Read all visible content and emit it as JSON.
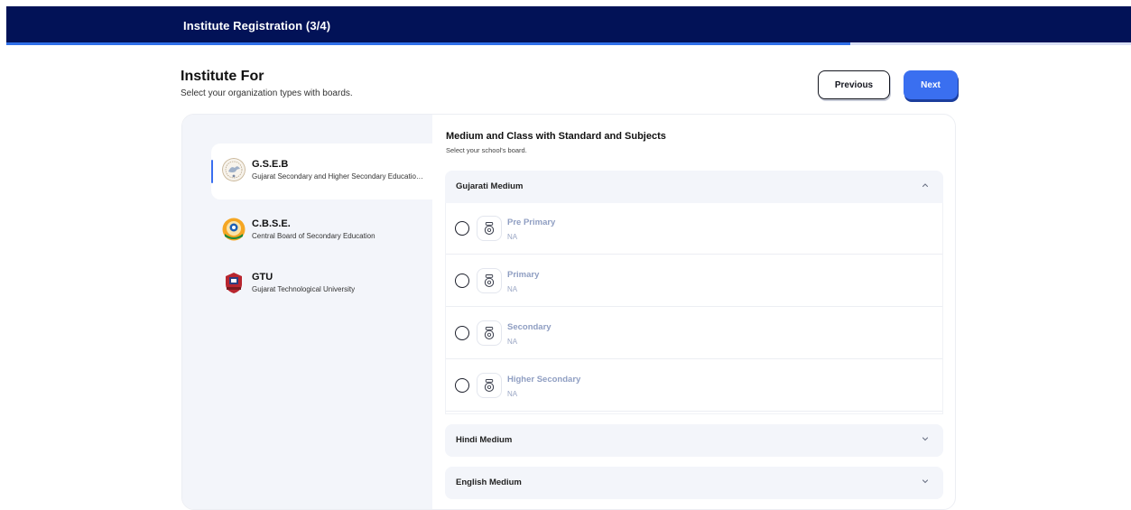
{
  "header": {
    "title": "Institute Registration (3/4)",
    "progress_percent": 75
  },
  "page": {
    "title": "Institute For",
    "subtitle": "Select your organization types with boards.",
    "previous_label": "Previous",
    "next_label": "Next"
  },
  "boards": [
    {
      "short": "G.S.E.B",
      "full": "Gujarat Secondary and Higher Secondary Education Board",
      "active": true,
      "icon": "gseb-logo"
    },
    {
      "short": "C.B.S.E.",
      "full": "Central Board of Secondary Education",
      "active": false,
      "icon": "cbse-logo"
    },
    {
      "short": "GTU",
      "full": "Gujarat Technological University",
      "active": false,
      "icon": "gtu-logo"
    }
  ],
  "main": {
    "title": "Medium and Class with Standard and Subjects",
    "subtitle": "Select your school's board."
  },
  "mediums": [
    {
      "label": "Gujarati Medium",
      "expanded": true,
      "classes": [
        {
          "title": "Pre Primary",
          "sub": "NA"
        },
        {
          "title": "Primary",
          "sub": "NA"
        },
        {
          "title": "Secondary",
          "sub": "NA"
        },
        {
          "title": "Higher Secondary",
          "sub": "NA"
        }
      ]
    },
    {
      "label": "Hindi Medium",
      "expanded": false
    },
    {
      "label": "English Medium",
      "expanded": false
    }
  ],
  "colors": {
    "header_bg": "#021257",
    "accent": "#3a6ff0",
    "muted_text": "#8f9ec2"
  }
}
